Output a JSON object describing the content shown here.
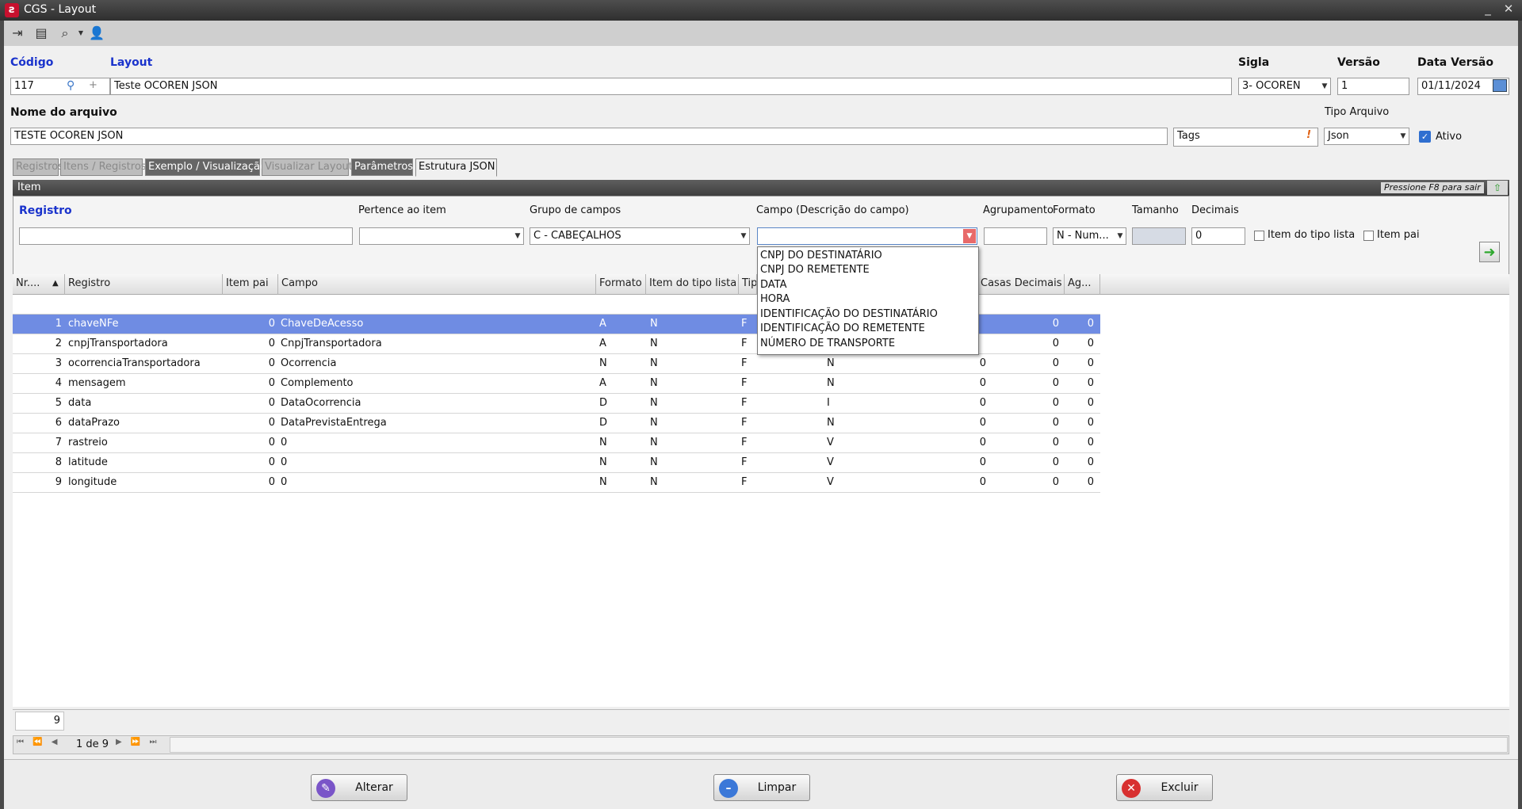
{
  "window": {
    "title": "CGS - Layout",
    "min": "_",
    "close": "✕"
  },
  "toolbar": {
    "icons": [
      "exit-icon",
      "card-icon",
      "search-icon",
      "user-icon"
    ]
  },
  "header": {
    "codigo_label": "Código",
    "codigo_value": "117",
    "layout_label": "Layout",
    "layout_value": "Teste OCOREN JSON",
    "sigla_label": "Sigla",
    "sigla_value": "3- OCOREN",
    "versao_label": "Versão",
    "versao_value": "1",
    "data_versao_label": "Data Versão",
    "data_versao_value": "01/11/2024",
    "nome_arquivo_label": "Nome do arquivo",
    "nome_arquivo_value": "TESTE OCOREN JSON",
    "tags_value": "Tags",
    "tags_alert": "!",
    "tipo_arquivo_label": "Tipo Arquivo",
    "tipo_arquivo_value": "Json",
    "ativo_label": "Ativo",
    "ativo_checked": true
  },
  "tabs": [
    {
      "label": "Registros",
      "state": "disabled"
    },
    {
      "label": "Itens / Registros",
      "state": "disabled"
    },
    {
      "label": "Exemplo / Visualização",
      "state": "normal"
    },
    {
      "label": "Visualizar Layout",
      "state": "disabled"
    },
    {
      "label": "Parâmetros",
      "state": "normal"
    },
    {
      "label": "Estrutura JSON",
      "state": "active"
    }
  ],
  "panel": {
    "title": "Item",
    "hint": "Pressione F8 para sair",
    "registro_label": "Registro",
    "registro_value": "",
    "pertence_label": "Pertence ao item",
    "pertence_value": "",
    "grupo_label": "Grupo de campos",
    "grupo_value": "C - CABEÇALHOS",
    "campo_label": "Campo (Descrição do campo)",
    "campo_value": "",
    "agrupamento_label": "Agrupamento",
    "agrupamento_value": "",
    "formato_label": "Formato",
    "formato_value": "N - Num...",
    "tamanho_label": "Tamanho",
    "tamanho_value": "",
    "decimais_label": "Decimais",
    "decimais_value": "0",
    "item_tipo_lista_label": "Item do tipo lista",
    "item_pai_label": "Item pai"
  },
  "dropdown": {
    "options": [
      "CNPJ DO DESTINATÁRIO",
      "CNPJ DO REMETENTE",
      "DATA",
      "HORA",
      "IDENTIFICAÇÃO DO DESTINATÁRIO",
      "IDENTIFICAÇÃO DO REMETENTE",
      "NÚMERO DE TRANSPORTE"
    ]
  },
  "grid": {
    "columns": [
      "Nr....",
      "Registro",
      "Item pai",
      "Campo",
      "Formato",
      "Item do tipo lista",
      "Tip",
      "",
      "Casas Decimais",
      "Ag..."
    ],
    "rows": [
      {
        "nr": "1",
        "registro": "chaveNFe",
        "item_pai": "0",
        "campo": "ChaveDeAcesso",
        "formato": "A",
        "lista": "N",
        "tipo": "F",
        "col8": "",
        "col9": "",
        "casas": "0",
        "ag": "0"
      },
      {
        "nr": "2",
        "registro": "cnpjTransportadora",
        "item_pai": "0",
        "campo": "CnpjTransportadora",
        "formato": "A",
        "lista": "N",
        "tipo": "F",
        "col8": "",
        "col9": "",
        "casas": "0",
        "ag": "0"
      },
      {
        "nr": "3",
        "registro": "ocorrenciaTransportadora",
        "item_pai": "0",
        "campo": "Ocorrencia",
        "formato": "N",
        "lista": "N",
        "tipo": "F",
        "col8": "N",
        "col9": "0",
        "casas": "0",
        "ag": "0"
      },
      {
        "nr": "4",
        "registro": "mensagem",
        "item_pai": "0",
        "campo": "Complemento",
        "formato": "A",
        "lista": "N",
        "tipo": "F",
        "col8": "N",
        "col9": "0",
        "casas": "0",
        "ag": "0"
      },
      {
        "nr": "5",
        "registro": "data",
        "item_pai": "0",
        "campo": "DataOcorrencia",
        "formato": "D",
        "lista": "N",
        "tipo": "F",
        "col8": "I",
        "col9": "0",
        "casas": "0",
        "ag": "0"
      },
      {
        "nr": "6",
        "registro": "dataPrazo",
        "item_pai": "0",
        "campo": "DataPrevistaEntrega",
        "formato": "D",
        "lista": "N",
        "tipo": "F",
        "col8": "N",
        "col9": "0",
        "casas": "0",
        "ag": "0"
      },
      {
        "nr": "7",
        "registro": "rastreio",
        "item_pai": "0",
        "campo": "0",
        "formato": "N",
        "lista": "N",
        "tipo": "F",
        "col8": "V",
        "col9": "0",
        "casas": "0",
        "ag": "0"
      },
      {
        "nr": "8",
        "registro": "latitude",
        "item_pai": "0",
        "campo": "0",
        "formato": "N",
        "lista": "N",
        "tipo": "F",
        "col8": "V",
        "col9": "0",
        "casas": "0",
        "ag": "0"
      },
      {
        "nr": "9",
        "registro": "longitude",
        "item_pai": "0",
        "campo": "0",
        "formato": "N",
        "lista": "N",
        "tipo": "F",
        "col8": "V",
        "col9": "0",
        "casas": "0",
        "ag": "0"
      }
    ],
    "footer_count": "9",
    "pager": "1 de 9"
  },
  "buttons": {
    "alterar": "Alterar",
    "limpar": "Limpar",
    "excluir": "Excluir"
  }
}
